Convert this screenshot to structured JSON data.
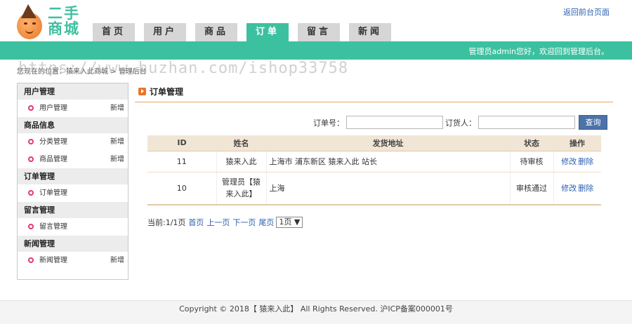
{
  "logo": {
    "line1": "二手",
    "line2": "商城"
  },
  "topnav": {
    "tabs": [
      {
        "label": "首页",
        "active": false
      },
      {
        "label": "用户",
        "active": false
      },
      {
        "label": "商品",
        "active": false
      },
      {
        "label": "订单",
        "active": true
      },
      {
        "label": "留言",
        "active": false
      },
      {
        "label": "新闻",
        "active": false
      }
    ]
  },
  "header": {
    "back_link": "返回前台页面",
    "welcome": "管理员admin您好，欢迎回到管理后台。"
  },
  "breadcrumb": "您现在的位置：猿来入此商城 > 管理后台",
  "watermark": "https://www.huzhan.com/ishop33758",
  "sidebar": {
    "groups": [
      {
        "title": "用户管理",
        "items": [
          {
            "label": "用户管理",
            "add": "新增"
          }
        ]
      },
      {
        "title": "商品信息",
        "items": [
          {
            "label": "分类管理",
            "add": "新增"
          },
          {
            "label": "商品管理",
            "add": "新增"
          }
        ]
      },
      {
        "title": "订单管理",
        "items": [
          {
            "label": "订单管理",
            "add": ""
          }
        ]
      },
      {
        "title": "留言管理",
        "items": [
          {
            "label": "留言管理",
            "add": ""
          }
        ]
      },
      {
        "title": "新闻管理",
        "items": [
          {
            "label": "新闻管理",
            "add": "新增"
          }
        ]
      }
    ]
  },
  "main": {
    "title": "订单管理",
    "search": {
      "order_no_label": "订单号：",
      "order_no_value": "",
      "buyer_label": "订货人：",
      "buyer_value": "",
      "button": "查询"
    },
    "table": {
      "headers": [
        "ID",
        "姓名",
        "发货地址",
        "状态",
        "操作"
      ],
      "rows": [
        {
          "id": "11",
          "name": "猿来入此",
          "address": "上海市 浦东新区 猿来入此 站长",
          "status": "待审核",
          "edit": "修改",
          "delete": "删除"
        },
        {
          "id": "10",
          "name": "管理员【猿来入此】",
          "address": "上海",
          "status": "审核通过",
          "edit": "修改",
          "delete": "删除"
        }
      ]
    },
    "pager": {
      "info": "当前:1/1页",
      "first": "首页",
      "prev": "上一页",
      "next": "下一页",
      "last": "尾页",
      "select": "1页"
    }
  },
  "footer": "Copyright © 2018【 猿来入此】 All Rights Reserved. 沪ICP备案000001号",
  "colors": {
    "accent": "#3cc1a0",
    "link": "#2b5fb0",
    "button": "#4c72a8"
  }
}
